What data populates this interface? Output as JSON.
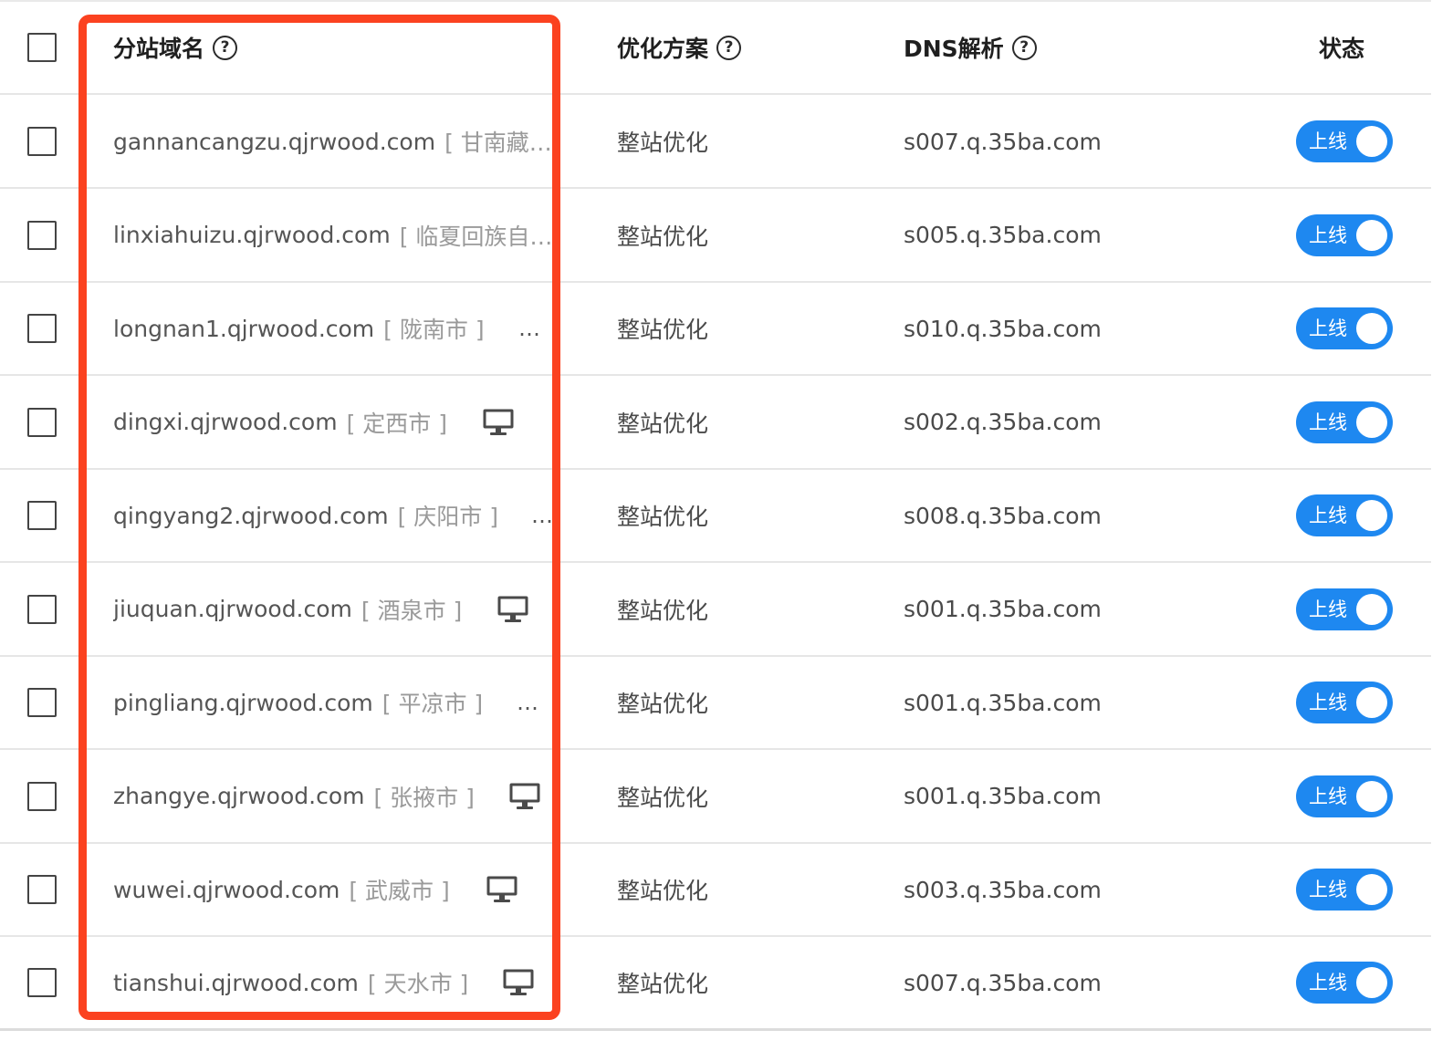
{
  "colors": {
    "highlight": "#fb4220",
    "toggle_on": "#1e88f0",
    "text_main": "#555555",
    "text_city": "#9a9a9a"
  },
  "header": {
    "domain": "分站域名",
    "plan": "优化方案",
    "dns": "DNS解析",
    "status": "状态",
    "help_glyph": "?"
  },
  "rows": [
    {
      "domain": "gannancangzu.qjrwood.com",
      "city": "[ 甘南藏…",
      "trail": "none",
      "plan": "整站优化",
      "dns": "s007.q.35ba.com",
      "status": "上线"
    },
    {
      "domain": "linxiahuizu.qjrwood.com",
      "city": "[ 临夏回族自…",
      "trail": "none",
      "plan": "整站优化",
      "dns": "s005.q.35ba.com",
      "status": "上线"
    },
    {
      "domain": "longnan1.qjrwood.com",
      "city": "[ 陇南市 ]",
      "trail": "dots",
      "plan": "整站优化",
      "dns": "s010.q.35ba.com",
      "status": "上线"
    },
    {
      "domain": "dingxi.qjrwood.com",
      "city": "[ 定西市 ]",
      "trail": "monitor-icon",
      "plan": "整站优化",
      "dns": "s002.q.35ba.com",
      "status": "上线"
    },
    {
      "domain": "qingyang2.qjrwood.com",
      "city": "[ 庆阳市 ]",
      "trail": "dots",
      "plan": "整站优化",
      "dns": "s008.q.35ba.com",
      "status": "上线"
    },
    {
      "domain": "jiuquan.qjrwood.com",
      "city": "[ 酒泉市 ]",
      "trail": "monitor-icon",
      "plan": "整站优化",
      "dns": "s001.q.35ba.com",
      "status": "上线"
    },
    {
      "domain": "pingliang.qjrwood.com",
      "city": "[ 平凉市 ]",
      "trail": "dots",
      "plan": "整站优化",
      "dns": "s001.q.35ba.com",
      "status": "上线"
    },
    {
      "domain": "zhangye.qjrwood.com",
      "city": "[ 张掖市 ]",
      "trail": "monitor-icon",
      "plan": "整站优化",
      "dns": "s001.q.35ba.com",
      "status": "上线"
    },
    {
      "domain": "wuwei.qjrwood.com",
      "city": "[ 武威市 ]",
      "trail": "monitor-icon",
      "plan": "整站优化",
      "dns": "s003.q.35ba.com",
      "status": "上线"
    },
    {
      "domain": "tianshui.qjrwood.com",
      "city": "[ 天水市 ]",
      "trail": "monitor-icon",
      "plan": "整站优化",
      "dns": "s007.q.35ba.com",
      "status": "上线"
    }
  ]
}
